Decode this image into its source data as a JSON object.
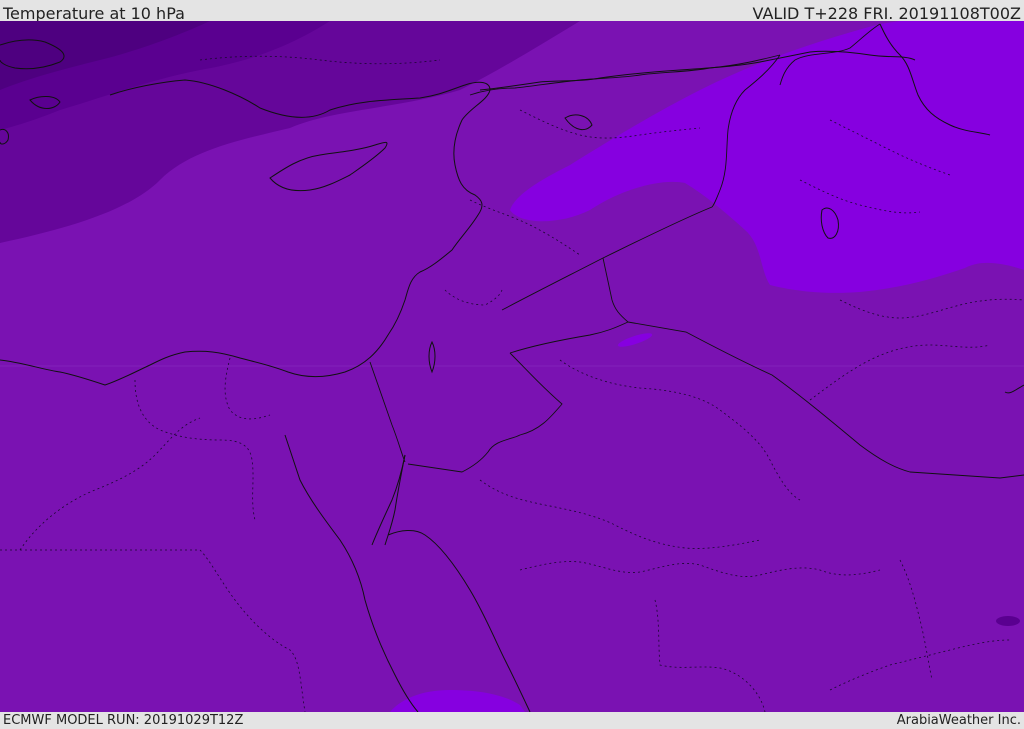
{
  "header": {
    "title": "Temperature at 10 hPa",
    "valid_time": "VALID T+228 FRI. 20191108T00Z"
  },
  "footer": {
    "model_run": "ECMWF MODEL RUN: 20191029T12Z",
    "credit": "ArabiaWeather Inc."
  },
  "map": {
    "field": "temperature",
    "level": "10 hPa",
    "region": "Eastern Mediterranean / Middle East",
    "colors": {
      "base_fill": "#7a12b2",
      "dark_band": "#65069a",
      "darker_band": "#5a0090",
      "darkest_band": "#4e0080",
      "warm_blob": "#8600e0",
      "coastline": "#111111",
      "border": "#111111",
      "admin_boundary": "#222222"
    }
  }
}
